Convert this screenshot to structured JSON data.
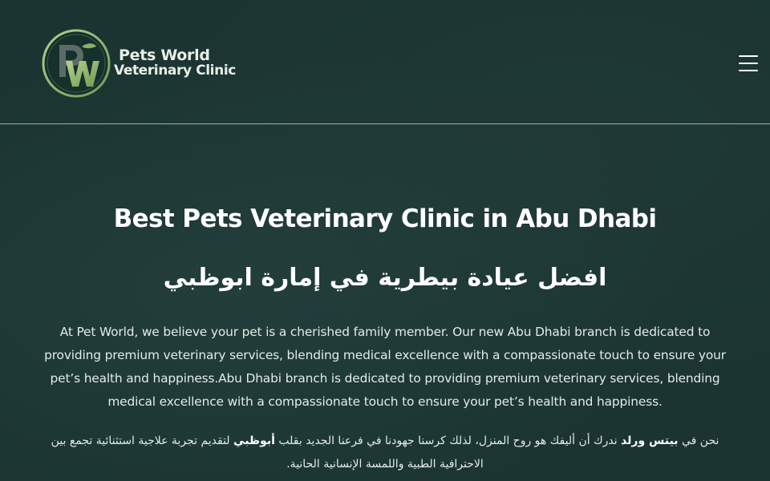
{
  "header": {
    "logo_monogram": "PW",
    "logo_line1": "Pets World",
    "logo_line2": "Veterinary Clinic",
    "menu_icon": "hamburger-menu-icon",
    "colors": {
      "background": "#1b3432",
      "logo_green": "#8ab06a",
      "divider": "#9fb1ae"
    }
  },
  "main": {
    "title_en": "Best Pets Veterinary Clinic in Abu Dhabi",
    "title_ar": "افضل عيادة بيطرية في إمارة ابوظبي",
    "paragraph_en": "At Pet World, we believe your pet is a cherished family member. Our new Abu Dhabi branch is dedicated to providing premium veterinary services, blending medical excellence with a compassionate touch to ensure your pet’s health and happiness.Abu Dhabi branch is dedicated to providing premium veterinary services, blending medical excellence with a compassionate touch to ensure your pet’s health and happiness.",
    "paragraph_ar": {
      "part1": "نحن في ",
      "bold1": "بيتس ورلد",
      "part2": " ندرك أن أليفك هو روح المنزل، لذلك كرسنا جهودنا في فرعنا الجديد بقلب ",
      "bold2": "أبوظبي",
      "part3": " لتقديم تجربة علاجية استثنائية تجمع بين الاحترافية الطبية واللمسة الإنسانية الحانية."
    }
  }
}
